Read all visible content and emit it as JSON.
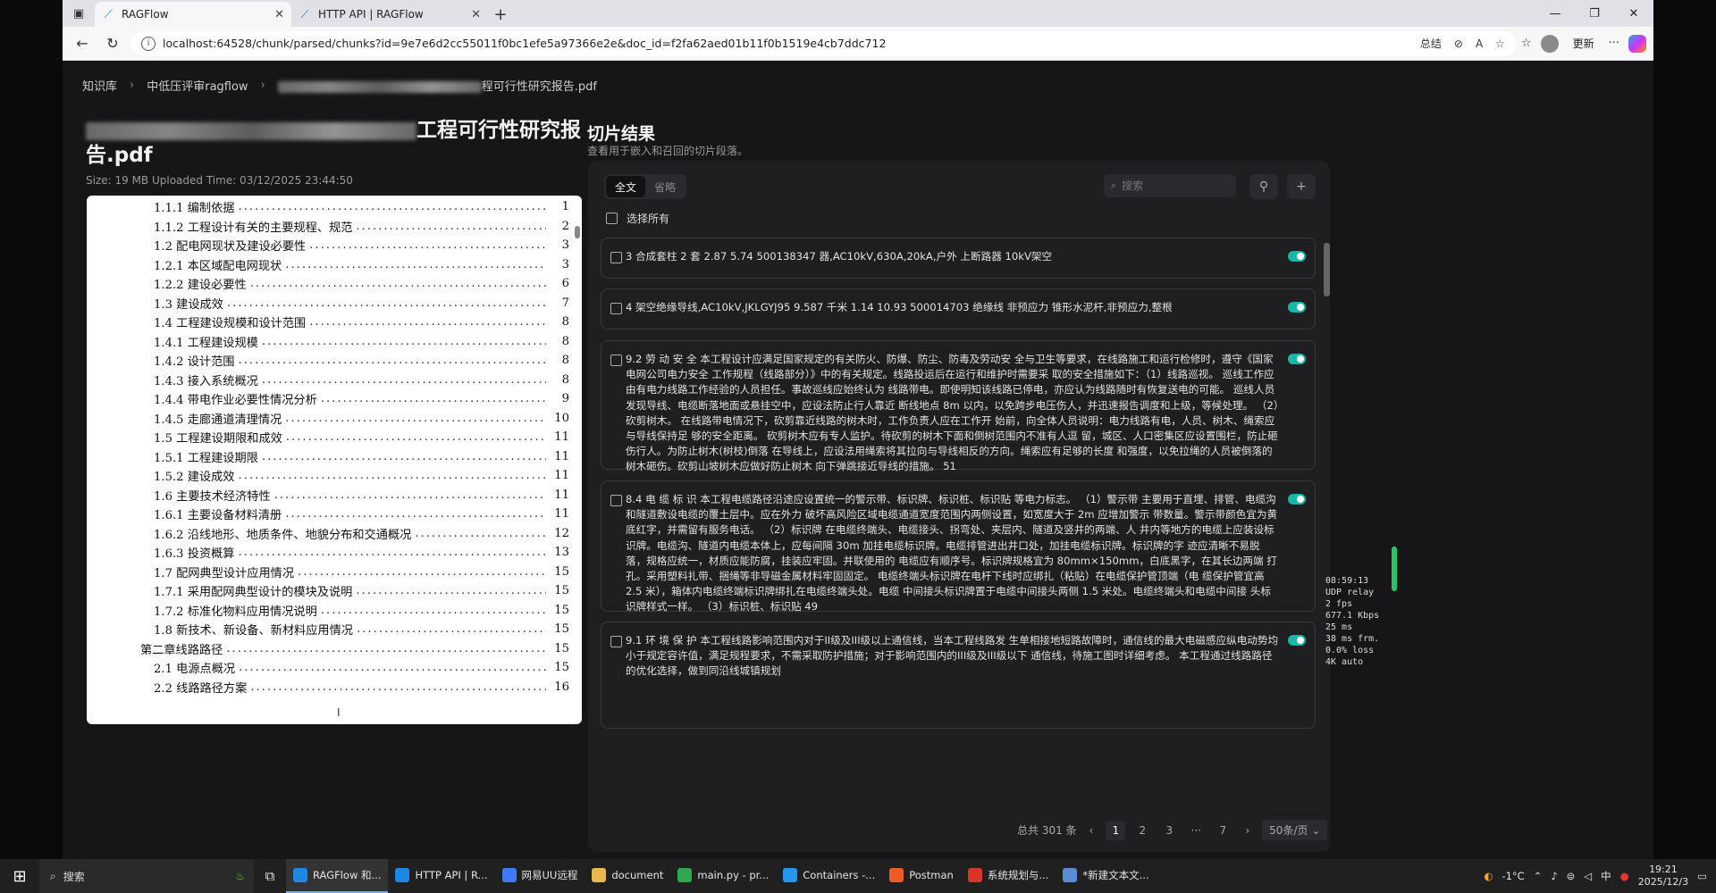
{
  "browser": {
    "tabs": [
      {
        "title": "RAGFlow",
        "active": true
      },
      {
        "title": "HTTP API | RAGFlow",
        "active": false
      }
    ],
    "url": "localhost:64528/chunk/parsed/chunks?id=9e7e6d2cc55011f0bc1efe5a97366e2e&doc_id=f2fa62aed01b11f0b1519e4cb7ddc712",
    "summary_label": "总结",
    "update_label": "更新"
  },
  "breadcrumb": {
    "root": "知识库",
    "kb": "中低压评审ragflow",
    "doc_suffix": "程可行性研究报告.pdf"
  },
  "document": {
    "title_suffix_line1": "工程可行性研究报",
    "title_line2": "告.pdf",
    "meta": "Size: 19 MB Uploaded Time: 03/12/2025 23:44:50",
    "toc": [
      {
        "label": "1.1.1 编制依据",
        "page": "1",
        "indent": 2
      },
      {
        "label": "1.1.2 工程设计有关的主要规程、规范",
        "page": "2",
        "indent": 2
      },
      {
        "label": "1.2 配电网现状及建设必要性",
        "page": "3",
        "indent": 2
      },
      {
        "label": "1.2.1 本区域配电网现状",
        "page": "3",
        "indent": 2
      },
      {
        "label": "1.2.2 建设必要性",
        "page": "6",
        "indent": 2
      },
      {
        "label": "1.3 建设成效",
        "page": "7",
        "indent": 2
      },
      {
        "label": "1.4 工程建设规模和设计范围",
        "page": "8",
        "indent": 2
      },
      {
        "label": "1.4.1 工程建设规模",
        "page": "8",
        "indent": 2
      },
      {
        "label": "1.4.2 设计范围",
        "page": "8",
        "indent": 2
      },
      {
        "label": "1.4.3 接入系统概况",
        "page": "8",
        "indent": 2
      },
      {
        "label": "1.4.4 带电作业必要性情况分析",
        "page": "9",
        "indent": 2
      },
      {
        "label": "1.4.5 走廊通道清理情况",
        "page": "10",
        "indent": 2
      },
      {
        "label": "1.5 工程建设期限和成效",
        "page": "11",
        "indent": 2
      },
      {
        "label": "1.5.1 工程建设期限",
        "page": "11",
        "indent": 2
      },
      {
        "label": "1.5.2 建设成效",
        "page": "11",
        "indent": 2
      },
      {
        "label": "1.6 主要技术经济特性",
        "page": "11",
        "indent": 2
      },
      {
        "label": "1.6.1 主要设备材料清册",
        "page": "11",
        "indent": 2
      },
      {
        "label": "1.6.2 沿线地形、地质条件、地貌分布和交通概况",
        "page": "12",
        "indent": 2
      },
      {
        "label": "1.6.3 投资概算",
        "page": "13",
        "indent": 2
      },
      {
        "label": "1.7 配网典型设计应用情况",
        "page": "15",
        "indent": 2
      },
      {
        "label": "1.7.1 采用配网典型设计的模块及说明",
        "page": "15",
        "indent": 2
      },
      {
        "label": "1.7.2 标准化物料应用情况说明",
        "page": "15",
        "indent": 2
      },
      {
        "label": "1.8 新技术、新设备、新材料应用情况",
        "page": "15",
        "indent": 2
      },
      {
        "label": "第二章线路路径",
        "page": "15",
        "indent": 1
      },
      {
        "label": "2.1 电源点概况",
        "page": "15",
        "indent": 2
      },
      {
        "label": "2.2 线路路径方案",
        "page": "16",
        "indent": 2
      }
    ],
    "cursor_glyph": "I"
  },
  "results": {
    "title": "切片结果",
    "subtitle": "查看用于嵌入和召回的切片段落。",
    "tabs": [
      "全文",
      "省略"
    ],
    "search_placeholder": "搜索",
    "select_all": "选择所有",
    "chunks": [
      {
        "text": "3 合成套柱 2 套 2.87 5.74 500138347 器,AC10kV,630A,20kA,户外 上断路器 10kV架空",
        "enabled": true
      },
      {
        "text": "4 架空绝缘导线,AC10kV,JKLGYJ95 9.587 千米 1.14 10.93 500014703 绝缘线 非预应力 锥形水泥杆,非预应力,整根",
        "enabled": true
      },
      {
        "text": "9.2 劳 动 安 全 本工程设计应满足国家规定的有关防火、防爆、防尘、防毒及劳动安 全与卫生等要求，在线路施工和运行检修时，遵守《国家电网公司电力安全 工作规程（线路部分）》中的有关规定。线路投运后在运行和维护时需要采 取的安全措施如下：（1）线路巡视。 巡线工作应由有电力线路工作经验的人员担任。事故巡线应始终认为 线路带电。即使明知该线路已停电，亦应认为线路随时有恢复送电的可能。 巡线人员发现导线、电缆断落地面或悬挂空中，应设法防止行人靠近 断线地点 8m 以内，以免跨步电压伤人，并迅速报告调度和上级，等候处理。 （2）砍剪树木。 在线路带电情况下，砍剪靠近线路的树木时，工作负责人应在工作开 始前，向全体人员说明：电力线路有电，人员、树木、绳索应与导线保持足 够的安全距离。 砍剪树木应有专人监护。待砍剪的树木下面和倒树范围内不准有人逗 留，城区、人口密集区应设置围栏，防止砸伤行人。为防止树木(树枝)倒落 在导线上，应设法用绳索将其拉向与导线相反的方向。绳索应有足够的长度 和强度，以免拉绳的人员被倒落的树木砸伤。砍剪山坡树木应做好防止树木 向下弹跳接近导线的措施。 51",
        "enabled": true
      },
      {
        "text": "8.4 电 缆 标 识 本工程电缆路径沿途应设置统一的警示带、标识牌、标识桩、标识贴 等电力标志。 （1）警示带 主要用于直埋、排管、电缆沟和隧道敷设电缆的覆土层中。应在外力 破坏高风险区域电缆通道宽度范围内两侧设置，如宽度大于 2m 应增加警示 带数量。警示带颜色宜为黄底红字，并需留有服务电话。 （2）标识牌 在电缆终端头、电缆接头、拐弯处、夹层内、隧道及竖井的两端、人 井内等地方的电缆上应装设标识牌。电缆沟、隧道内电缆本体上，应每间隔 30m 加挂电缆标识牌。电缆排管进出井口处，加挂电缆标识牌。标识牌的字 迹应清晰不易脱落，规格应统一，材质应能防腐，挂装应牢固。并联使用的 电缆应有顺序号。标识牌规格宜为 80mm×150mm，白底黑字，在其长边两端 打孔。采用塑料扎带、捆绳等非导磁金属材料牢固固定。 电缆终端头标识牌在电杆下线时应绑扎（粘贴）在电缆保护管顶端（电 缆保护管宜高 2.5 米），箱体内电缆终端标识牌绑扎在电缆终端头处。电缆 中间接头标识牌置于电缆中间接头两侧 1.5 米处。电缆终端头和电缆中间接 头标识牌样式一样。 （3）标识桩、标识贴 49",
        "enabled": true
      },
      {
        "text": "9.1 环 境 保 护 本工程线路影响范围内对于II级及III级以上通信线，当本工程线路发 生单相接地短路故障时，通信线的最大电磁感应纵电动势均小于规定容许值，满足规程要求，不需采取防护措施；对于影响范围内的III级及III级以下 通信线，待施工图时详细考虑。 本工程通过线路路径的优化选择，做到同沿线城镇规划",
        "enabled": true
      }
    ],
    "pagination": {
      "total": "总共 301 条",
      "pages": [
        "1",
        "2",
        "3",
        "···",
        "7"
      ],
      "current": "1",
      "page_size": "50条/页"
    }
  },
  "stats_overlay": [
    "08:59:13",
    "UDP relay",
    "2 fps",
    "677.1 Kbps",
    "25 ms",
    "38 ms frm.",
    "0.0% loss",
    "4K auto"
  ],
  "taskbar": {
    "search_label": "搜索",
    "apps": [
      {
        "label": "RAGFlow 和...",
        "color": "#1e88e5",
        "active": true
      },
      {
        "label": "HTTP API | R...",
        "color": "#1e88e5",
        "active": false
      },
      {
        "label": "网易UU远程",
        "color": "#3d7bf7",
        "active": false
      },
      {
        "label": "document",
        "color": "#e8b84a",
        "active": false
      },
      {
        "label": "main.py - pr...",
        "color": "#2fa84f",
        "active": false
      },
      {
        "label": "Containers -...",
        "color": "#2496ed",
        "active": false
      },
      {
        "label": "Postman",
        "color": "#ef5b25",
        "active": false
      },
      {
        "label": "系统规划与...",
        "color": "#d9362b",
        "active": false
      },
      {
        "label": "*新建文本文...",
        "color": "#5a8dd6",
        "active": false
      }
    ],
    "weather": "-1°C",
    "ime": "中",
    "time": "19:21",
    "date": "2025/12/3"
  }
}
